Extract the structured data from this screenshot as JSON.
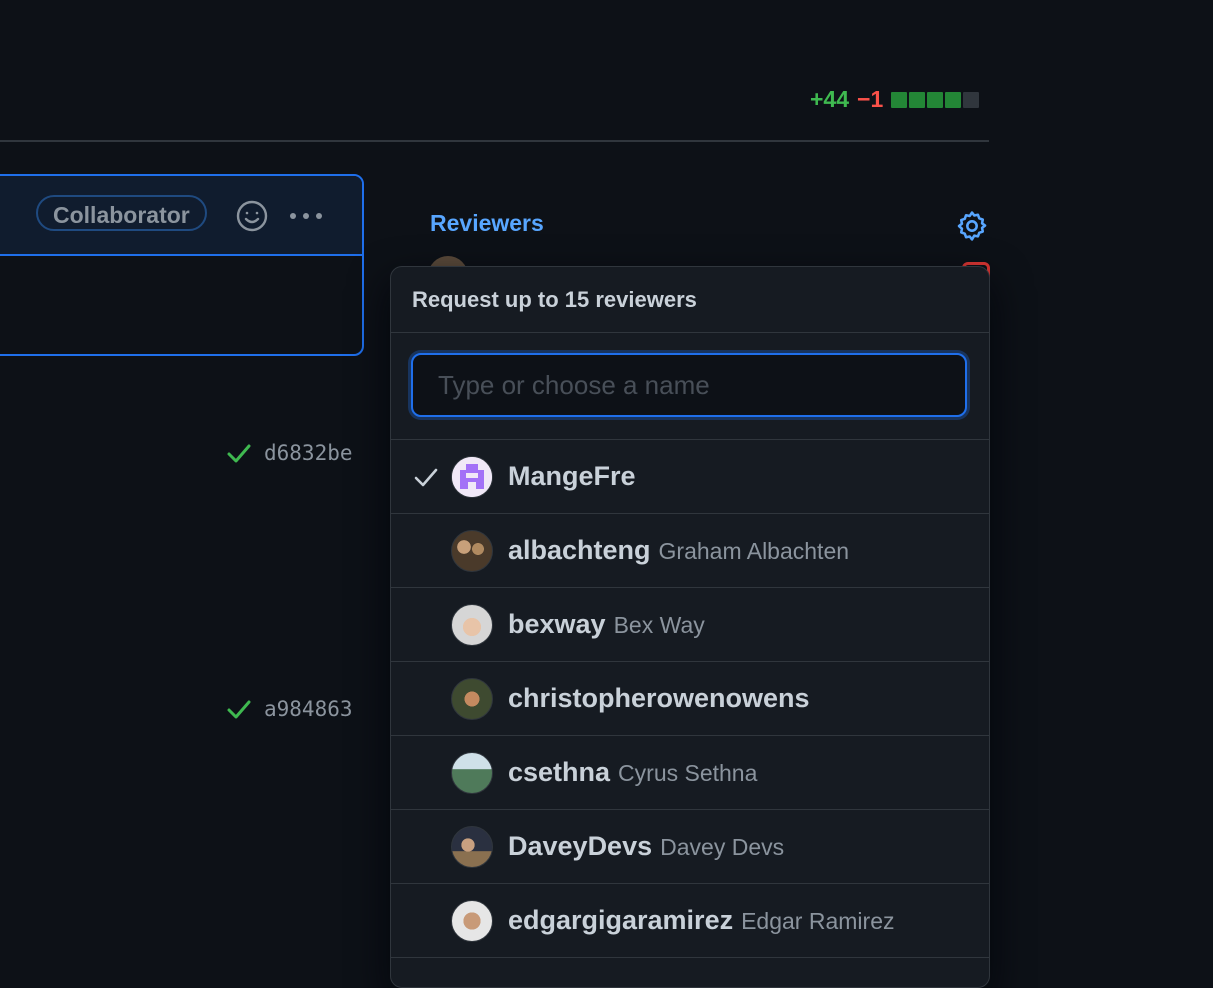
{
  "diffstat": {
    "additions": "+44",
    "deletions": "−1",
    "blocks": [
      "#238636",
      "#238636",
      "#238636",
      "#238636",
      "#30363d"
    ]
  },
  "comment": {
    "badge": "Collaborator"
  },
  "commits": [
    {
      "sha": "d6832be"
    },
    {
      "sha": "a984863"
    }
  ],
  "sidebar": {
    "reviewers_title": "Reviewers"
  },
  "reviewer_menu": {
    "header": "Request up to 15 reviewers",
    "filter_placeholder": "Type or choose a name",
    "filter_value": "",
    "items": [
      {
        "login": "MangeFre",
        "name": "",
        "selected": true,
        "avatar_color": "#a371f7"
      },
      {
        "login": "albachteng",
        "name": "Graham Albachten",
        "selected": false,
        "avatar_color": "#6e5a3e"
      },
      {
        "login": "bexway",
        "name": "Bex Way",
        "selected": false,
        "avatar_color": "#d9c2b0"
      },
      {
        "login": "christopherowenowens",
        "name": "",
        "selected": false,
        "avatar_color": "#4a5a3a"
      },
      {
        "login": "csethna",
        "name": "Cyrus Sethna",
        "selected": false,
        "avatar_color": "#4f7a5a"
      },
      {
        "login": "DaveyDevs",
        "name": "Davey Devs",
        "selected": false,
        "avatar_color": "#3a4a5e"
      },
      {
        "login": "edgargigaramirez",
        "name": "Edgar Ramirez",
        "selected": false,
        "avatar_color": "#b08a70"
      }
    ]
  },
  "colors": {
    "accent": "#1f6feb",
    "link": "#58a6ff",
    "success": "#3fb950",
    "danger": "#f85149",
    "bg": "#0d1117",
    "overlay": "#161b22"
  }
}
